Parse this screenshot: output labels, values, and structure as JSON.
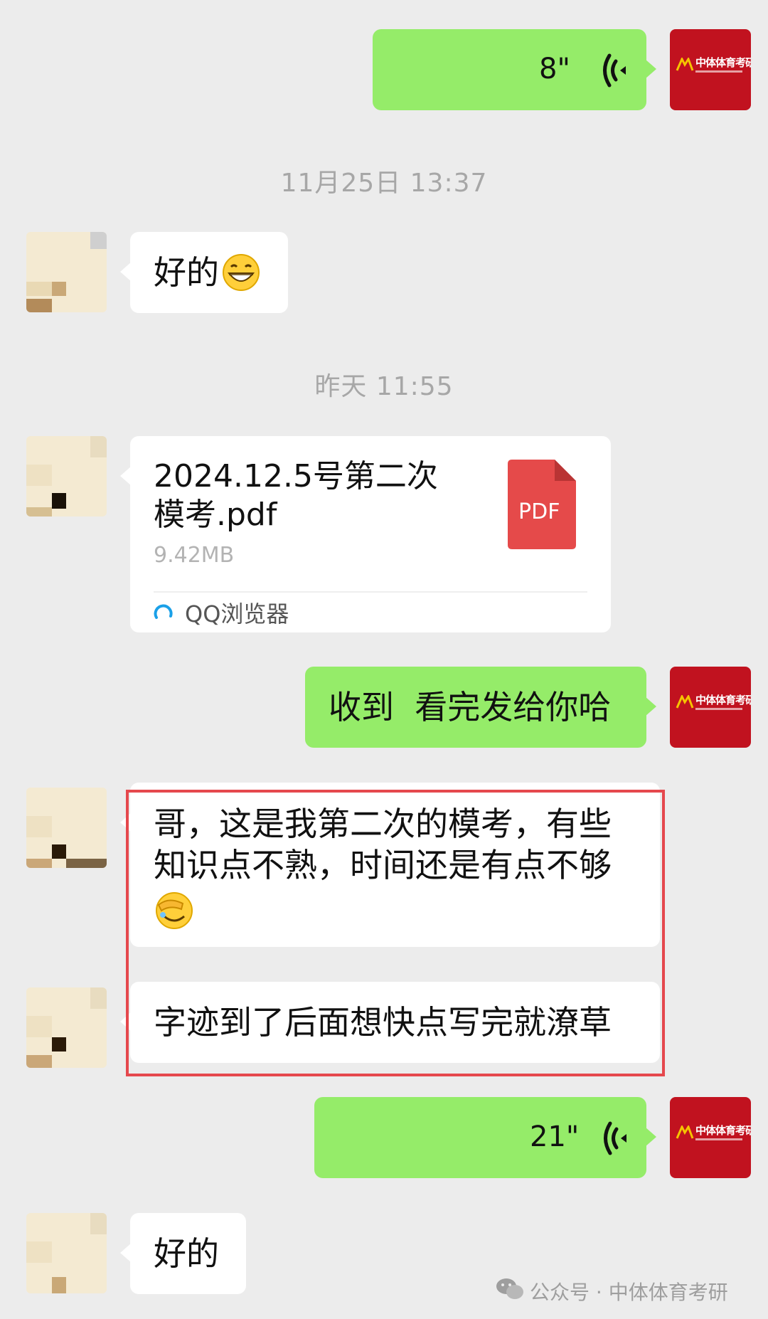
{
  "messages": {
    "voice1": {
      "duration": "8\""
    },
    "timestamp1": "11月25日 13:37",
    "reply1": {
      "text": "好的",
      "emoji": "grinning-face-emoji"
    },
    "timestamp2": "昨天 11:55",
    "file": {
      "title_line1": "2024.12.5号第二次",
      "title_line2": "模考.pdf",
      "size": "9.42MB",
      "pdf_label": "PDF",
      "app": "QQ浏览器"
    },
    "reply2": {
      "text": "收到  看完发给你哈"
    },
    "msg3": {
      "line1": "哥，这是我第二次的模考，有些",
      "line2": "知识点不熟，时间还是有点不够",
      "emoji": "face-palm-emoji"
    },
    "msg4": {
      "text": "字迹到了后面想快点写完就潦草"
    },
    "voice2": {
      "duration": "21\""
    },
    "reply3": {
      "text": "好的"
    }
  },
  "avatar_right": {
    "logo_text": "中体体育考研"
  },
  "watermark": {
    "text": "公众号 · 中体体育考研"
  },
  "colors": {
    "background": "#ececec",
    "bubble_self": "#95ec69",
    "bubble_other": "#ffffff",
    "highlight": "#e5484d",
    "pdf_red": "#e54a4a",
    "avatar_red": "#c1121f"
  }
}
